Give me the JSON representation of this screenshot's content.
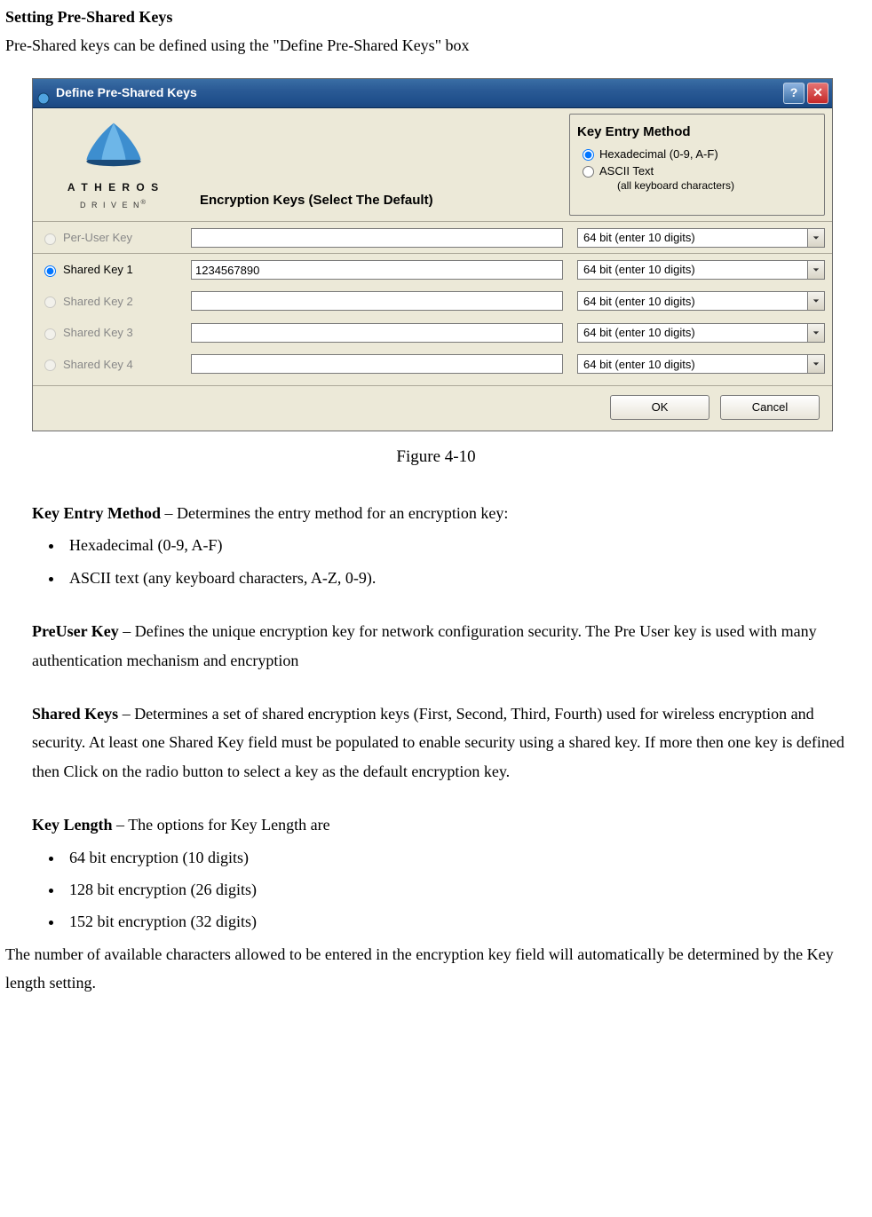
{
  "heading": "Setting Pre-Shared Keys",
  "intro": "Pre-Shared keys can be defined using the \"Define Pre-Shared Keys\" box",
  "dialog": {
    "title": "Define Pre-Shared Keys",
    "logo_text": "A T H E R O S",
    "logo_sub": "D R I V E N",
    "encryption_header": "Encryption Keys (Select The Default)",
    "kem": {
      "title": "Key Entry Method",
      "opt_hex": "Hexadecimal (0-9, A-F)",
      "opt_ascii": "ASCII Text",
      "opt_ascii_sub": "(all keyboard characters)"
    },
    "rows": {
      "peruser_label": "Per-User Key",
      "shared1_label": "Shared Key 1",
      "shared2_label": "Shared Key 2",
      "shared3_label": "Shared Key 3",
      "shared4_label": "Shared Key 4",
      "shared1_value": "1234567890",
      "select_value": "64 bit (enter 10 digits)"
    },
    "buttons": {
      "ok": "OK",
      "cancel": "Cancel"
    }
  },
  "figure_caption": "Figure 4-10",
  "sections": {
    "kem": {
      "label": "Key Entry Method",
      "desc": " – Determines the entry method for an encryption key:",
      "items": [
        "Hexadecimal (0-9, A-F)",
        "ASCII text (any keyboard characters, A-Z, 0-9)."
      ]
    },
    "preuser": {
      "label": "PreUser Key",
      "desc": " – Defines the unique encryption key for network configuration security.      The Pre User key is used with many authentication mechanism and encryption"
    },
    "shared": {
      "label": "Shared Keys",
      "desc": " – Determines a set of shared encryption keys (First, Second, Third, Fourth) used for wireless encryption and security.      At least one Shared Key field must be populated to enable security using a shared key.      If more then one key is defined then Click on the radio button to select a key as the default encryption key."
    },
    "keylen": {
      "label": "Key Length",
      "desc": " – The options for Key Length are",
      "items": [
        "64 bit encryption (10 digits)",
        "128 bit encryption (26 digits)",
        "152 bit encryption (32 digits)"
      ]
    }
  },
  "tail_note": "The number of available characters allowed to be entered in the encryption key field will automatically be determined by the Key length setting."
}
